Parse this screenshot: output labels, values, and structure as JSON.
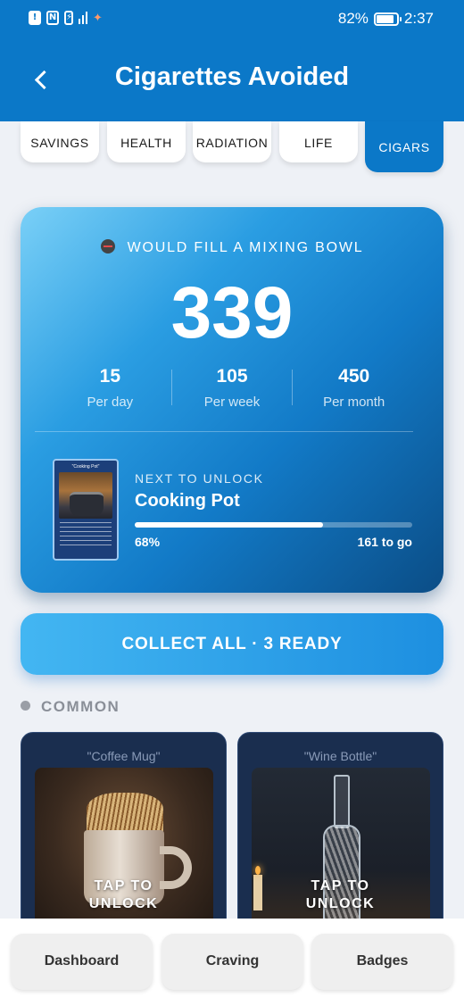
{
  "status_bar": {
    "battery": "82%",
    "time": "2:37",
    "left_icons": [
      "alert-icon",
      "nfc-icon",
      "battery-saver-icon",
      "signal-icon",
      "ai-star-icon"
    ]
  },
  "header": {
    "title": "Cigarettes Avoided",
    "back_icon": "back-chevron-icon"
  },
  "tabs": [
    {
      "label": "SAVINGS",
      "active": false
    },
    {
      "label": "HEALTH",
      "active": false
    },
    {
      "label": "RADIATION",
      "active": false
    },
    {
      "label": "LIFE",
      "active": false
    },
    {
      "label": "CIGARS",
      "active": true
    }
  ],
  "hero": {
    "tagline": "WOULD FILL A MIXING BOWL",
    "tag_icon": "no-smoking-icon",
    "count": "339",
    "stats": [
      {
        "value": "15",
        "label": "Per day"
      },
      {
        "value": "105",
        "label": "Per week"
      },
      {
        "value": "450",
        "label": "Per month"
      }
    ],
    "next": {
      "label": "NEXT TO UNLOCK",
      "name": "Cooking Pot",
      "thumb_title": "\"Cooking Pot\"",
      "progress_fraction": 0.68,
      "percent_text": "68%",
      "togo_text": "161 to go"
    }
  },
  "collect_button": "COLLECT ALL · 3 READY",
  "section": {
    "title": "COMMON"
  },
  "cards": [
    {
      "title": "\"Coffee Mug\"",
      "cta_line1": "TAP TO",
      "cta_line2": "UNLOCK"
    },
    {
      "title": "\"Wine Bottle\"",
      "cta_line1": "TAP TO",
      "cta_line2": "UNLOCK"
    }
  ],
  "bottom_nav": [
    {
      "label": "Dashboard"
    },
    {
      "label": "Craving"
    },
    {
      "label": "Badges"
    }
  ],
  "colors": {
    "primary": "#0b78c8",
    "accent": "#1d8fe0",
    "card_bg": "#1a2e4f"
  }
}
